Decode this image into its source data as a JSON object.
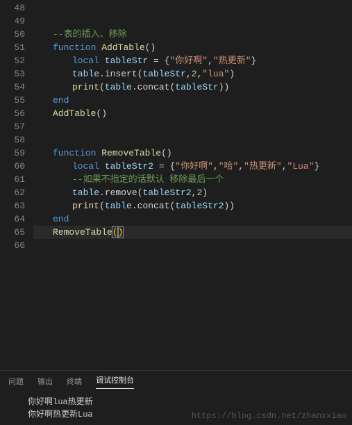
{
  "lines": {
    "start": 48,
    "end": 66
  },
  "code": {
    "l50_comment": "--表的插入、移除",
    "l51_kw": "function",
    "l51_fn": "AddTable",
    "l51_paren": "()",
    "l52_local": "local",
    "l52_var": "tableStr",
    "l52_eq": " = {",
    "l52_s1": "\"你好啊\"",
    "l52_c": ",",
    "l52_s2": "\"热更新\"",
    "l52_close": "}",
    "l53_var": "table",
    "l53_method": ".insert(",
    "l53_a1": "tableStr",
    "l53_c": ",",
    "l53_n": "2",
    "l53_s": "\"lua\"",
    "l53_close": ")",
    "l54_fn": "print",
    "l54_open": "(",
    "l54_tbl": "table",
    "l54_concat": ".concat(",
    "l54_var": "tableStr",
    "l54_close": "))",
    "l55_end": "end",
    "l56_call": "AddTable",
    "l56_paren": "()",
    "l59_kw": "function",
    "l59_fn": "RemoveTable",
    "l59_paren": "()",
    "l60_local": "local",
    "l60_var": "tableStr2",
    "l60_eq": " = {",
    "l60_s1": "\"你好啊\"",
    "l60_s2": "\"哈\"",
    "l60_s3": "\"热更新\"",
    "l60_s4": "\"Lua\"",
    "l60_close": "}",
    "l61_comment": "--如果不指定的话默认 移除最后一个",
    "l62_var": "table",
    "l62_method": ".remove(",
    "l62_a1": "tableStr2",
    "l62_n": "2",
    "l62_close": ")",
    "l63_fn": "print",
    "l63_open": "(",
    "l63_tbl": "table",
    "l63_concat": ".concat(",
    "l63_var": "tableStr2",
    "l63_close": "))",
    "l64_end": "end",
    "l65_call": "RemoveTable",
    "l65_p1": "(",
    "l65_p2": ")"
  },
  "tabs": {
    "problems": "问题",
    "output": "输出",
    "terminal": "终端",
    "debug": "调试控制台"
  },
  "console": {
    "line1": "你好啊lua热更新",
    "line2": "你好啊热更新Lua"
  },
  "watermark": "https://blog.csdn.net/zhanxxiao",
  "watermark2": ""
}
